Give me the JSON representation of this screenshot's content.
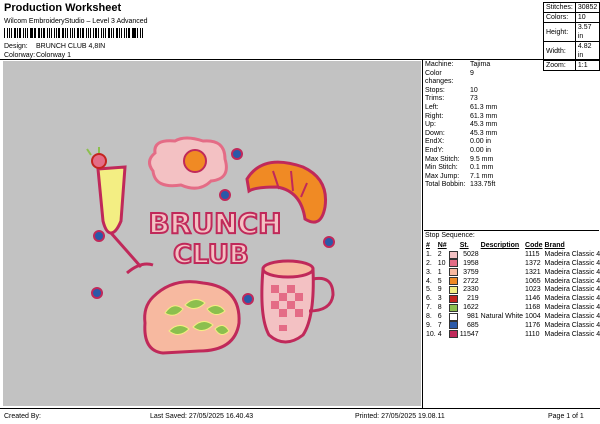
{
  "header": {
    "title": "Production Worksheet",
    "subtitle": "Wilcom EmbroideryStudio – Level 3 Advanced",
    "design_label": "Design:",
    "design_value": "BRUNCH CLUB 4,8IN",
    "colorway_label": "Colorway:",
    "colorway_value": "Colorway 1"
  },
  "summary": [
    {
      "k": "Stitches:",
      "v": "30852"
    },
    {
      "k": "Colors:",
      "v": "10"
    },
    {
      "k": "Height:",
      "v": "3.57 in"
    },
    {
      "k": "Width:",
      "v": "4.82 in"
    },
    {
      "k": "Zoom:",
      "v": "1:1"
    }
  ],
  "design_text": {
    "line1": "BRUNCH",
    "line2": "CLUB"
  },
  "machine": [
    {
      "k": "Machine:",
      "v": "Tajima"
    },
    {
      "k": "Color changes:",
      "v": "9"
    },
    {
      "k": "Stops:",
      "v": "10"
    },
    {
      "k": "Trims:",
      "v": "73"
    },
    {
      "k": "Left:",
      "v": "61.3 mm"
    },
    {
      "k": "Right:",
      "v": "61.3 mm"
    },
    {
      "k": "Up:",
      "v": "45.3 mm"
    },
    {
      "k": "Down:",
      "v": "45.3 mm"
    },
    {
      "k": "EndX:",
      "v": "0.00 in"
    },
    {
      "k": "EndY:",
      "v": "0.00 in"
    },
    {
      "k": "Max Stitch:",
      "v": "9.5 mm"
    },
    {
      "k": "Min Stitch:",
      "v": "0.1 mm"
    },
    {
      "k": "Max Jump:",
      "v": "7.1 mm"
    },
    {
      "k": "Total Bobbin:",
      "v": "133.75ft"
    }
  ],
  "stop_sequence": {
    "title": "Stop Sequence:",
    "headers": [
      "#",
      "N#",
      "",
      "St.",
      "Description",
      "Code",
      "Brand"
    ],
    "rows": [
      {
        "n": "1.",
        "num": "2",
        "color": "#f3c1c3",
        "st": "5028",
        "desc": "",
        "code": "1115",
        "brand": "Madeira Classic 40"
      },
      {
        "n": "2.",
        "num": "10",
        "color": "#e46c86",
        "st": "1958",
        "desc": "",
        "code": "1372",
        "brand": "Madeira Classic 40"
      },
      {
        "n": "3.",
        "num": "1",
        "color": "#f7b9a0",
        "st": "3759",
        "desc": "",
        "code": "1321",
        "brand": "Madeira Classic 40"
      },
      {
        "n": "4.",
        "num": "5",
        "color": "#f08a24",
        "st": "2722",
        "desc": "",
        "code": "1065",
        "brand": "Madeira Classic 40"
      },
      {
        "n": "5.",
        "num": "9",
        "color": "#f3ee83",
        "st": "2330",
        "desc": "",
        "code": "1023",
        "brand": "Madeira Classic 40"
      },
      {
        "n": "6.",
        "num": "3",
        "color": "#c4241f",
        "st": "219",
        "desc": "",
        "code": "1146",
        "brand": "Madeira Classic 40"
      },
      {
        "n": "7.",
        "num": "8",
        "color": "#8cbf4e",
        "st": "1622",
        "desc": "",
        "code": "1168",
        "brand": "Madeira Classic 40"
      },
      {
        "n": "8.",
        "num": "6",
        "color": "#ffffff",
        "st": "981",
        "desc": "Natural White",
        "code": "1004",
        "brand": "Madeira Classic 40"
      },
      {
        "n": "9.",
        "num": "7",
        "color": "#2a59a8",
        "st": "685",
        "desc": "",
        "code": "1176",
        "brand": "Madeira Classic 40"
      },
      {
        "n": "10.",
        "num": "4",
        "color": "#c0295a",
        "st": "11547",
        "desc": "",
        "code": "1110",
        "brand": "Madeira Classic 40"
      }
    ]
  },
  "footer": {
    "created": "Created By:",
    "saved": "Last Saved: 27/05/2025 16.40.43",
    "printed": "Printed: 27/05/2025 19.08.11",
    "page": "Page 1 of 1"
  }
}
